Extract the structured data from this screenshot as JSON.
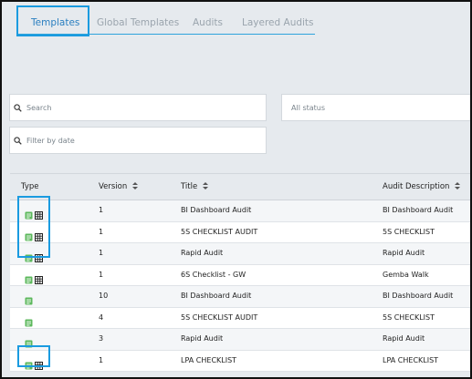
{
  "tabs": [
    {
      "label": "Templates",
      "active": true
    },
    {
      "label": "Global Templates",
      "active": false
    },
    {
      "label": "Audits",
      "active": false
    },
    {
      "label": "Layered Audits",
      "active": false
    }
  ],
  "filters": {
    "search_placeholder": "Search",
    "status_placeholder": "All status",
    "date_placeholder": "Filter by date"
  },
  "table": {
    "columns": [
      "Type",
      "Version",
      "Title",
      "Audit Description"
    ],
    "rows": [
      {
        "icons": [
          "doc-icon",
          "grid-icon"
        ],
        "version": "1",
        "title": "BI Dashboard Audit",
        "description": "BI Dashboard Audit"
      },
      {
        "icons": [
          "doc-icon",
          "grid-icon"
        ],
        "version": "1",
        "title": "5S CHECKLIST AUDIT",
        "description": "5S CHECKLIST"
      },
      {
        "icons": [
          "doc-icon",
          "grid-icon"
        ],
        "version": "1",
        "title": "Rapid Audit",
        "description": "Rapid Audit"
      },
      {
        "icons": [
          "doc-icon",
          "grid-icon"
        ],
        "version": "1",
        "title": "6S Checklist - GW",
        "description": "Gemba Walk"
      },
      {
        "icons": [
          "doc-icon"
        ],
        "version": "10",
        "title": "BI Dashboard Audit",
        "description": "BI Dashboard Audit"
      },
      {
        "icons": [
          "doc-icon"
        ],
        "version": "4",
        "title": "5S CHECKLIST AUDIT",
        "description": "5S CHECKLIST"
      },
      {
        "icons": [
          "doc-icon"
        ],
        "version": "3",
        "title": "Rapid Audit",
        "description": "Rapid Audit"
      },
      {
        "icons": [
          "doc-icon",
          "grid-icon"
        ],
        "version": "1",
        "title": "LPA CHECKLIST",
        "description": "LPA CHECKLIST"
      }
    ]
  },
  "colors": {
    "accent": "#2a7fc0",
    "highlight": "#1a9be0",
    "doc_icon": "#5cb85c",
    "background": "#e6eaee"
  }
}
